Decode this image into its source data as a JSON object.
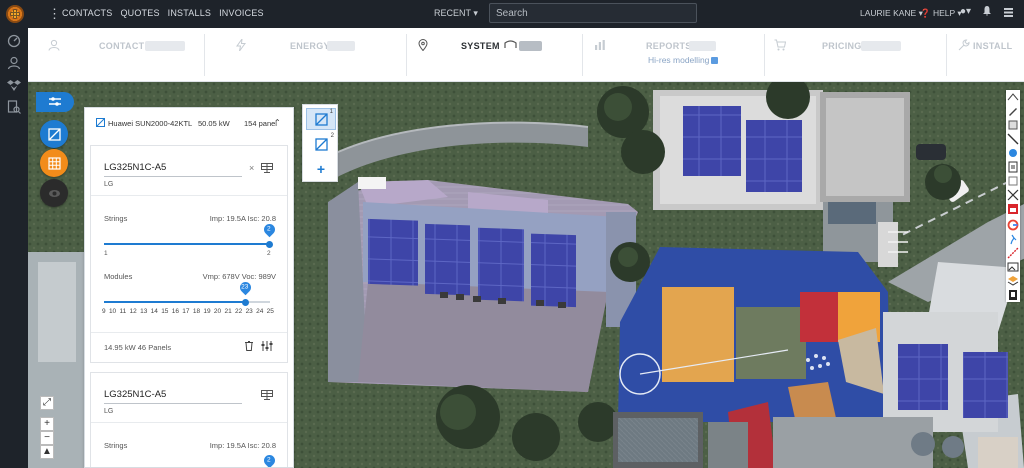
{
  "topbar": {
    "nav": [
      "CONTACTS",
      "QUOTES",
      "INSTALLS",
      "INVOICES"
    ],
    "recent": "RECENT ▾",
    "search_placeholder": "Search",
    "user": "LAURIE KANE ▾",
    "help": "❓ HELP ▾"
  },
  "steps": [
    {
      "label": "CONTACT",
      "icon": "person-icon",
      "active": false
    },
    {
      "label": "ENERGY",
      "icon": "lightning-icon",
      "active": false
    },
    {
      "label": "SYSTEM",
      "icon": "location-pin-icon",
      "active": true
    },
    {
      "label": "REPORTS",
      "icon": "bar-chart-icon",
      "active": false,
      "sub": "Hi-res modelling"
    },
    {
      "label": "PRICING",
      "icon": "cart-icon",
      "active": false
    },
    {
      "label": "INSTALL",
      "icon": "wrench-icon",
      "active": false
    }
  ],
  "panel": {
    "inverter": "Huawei SUN2000-42KTL",
    "power": "50.05 kW",
    "panel_count": "154 panel",
    "cards": [
      {
        "module": "LG325N1C-A5",
        "brand": "LG",
        "strings_label": "Strings",
        "strings_info": "Imp: 19.5A Isc: 20.8",
        "strings_value": "2",
        "strings_min": "1",
        "strings_max": "2",
        "modules_label": "Modules",
        "modules_info": "Vmp: 678V Voc: 989V",
        "modules_value": "23",
        "modules_ticks": [
          "9",
          "10",
          "11",
          "12",
          "13",
          "14",
          "15",
          "16",
          "17",
          "18",
          "19",
          "20",
          "21",
          "22",
          "23",
          "24",
          "25"
        ],
        "summary": "14.95 kW 46 Panels"
      },
      {
        "module": "LG325N1C-A5",
        "brand": "LG",
        "strings_label": "Strings",
        "strings_info": "Imp: 19.5A Isc: 20.8",
        "strings_value": "2"
      }
    ]
  },
  "arrays": [
    {
      "num": "1",
      "icon": "solar-panel-icon",
      "active": true
    },
    {
      "num": "2",
      "icon": "solar-panel-icon",
      "active": false
    }
  ],
  "colors": {
    "accent": "#1e7bd1",
    "topbar": "#1e232a",
    "panel_fill": "#3c44a6",
    "orange": "#f28c1a"
  }
}
